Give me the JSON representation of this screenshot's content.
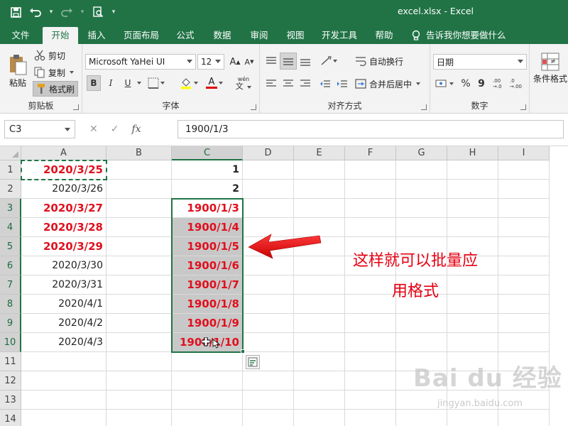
{
  "window": {
    "title": "excel.xlsx  -  Excel"
  },
  "tabs": [
    "文件",
    "开始",
    "插入",
    "页面布局",
    "公式",
    "数据",
    "审阅",
    "视图",
    "开发工具",
    "帮助"
  ],
  "active_tab": "开始",
  "tell_me": "告诉我你想要做什么",
  "ribbon": {
    "clipboard": {
      "paste": "粘贴",
      "cut": "剪切",
      "copy": "复制",
      "format_painter": "格式刷",
      "label": "剪贴板"
    },
    "font": {
      "name": "Microsoft YaHei UI",
      "size": "12",
      "bold": "B",
      "italic": "I",
      "underline": "U",
      "label": "字体",
      "phonetic": "wén",
      "font_color_glyph": "A"
    },
    "alignment": {
      "wrap": "自动换行",
      "merge": "合并后居中",
      "label": "对齐方式"
    },
    "number": {
      "format": "日期",
      "percent": "%",
      "comma": "9",
      "inc": ".00 →.0",
      "dec": ".0 →.00",
      "label": "数字"
    },
    "styles": {
      "conditional": "条件格式"
    }
  },
  "formula_bar": {
    "name_box": "C3",
    "fx": "fx",
    "value": "1900/1/3"
  },
  "columns": [
    "A",
    "B",
    "C",
    "D",
    "E",
    "F",
    "G",
    "H",
    "I"
  ],
  "rows": [
    "1",
    "2",
    "3",
    "4",
    "5",
    "6",
    "7",
    "8",
    "9",
    "10",
    "11",
    "12",
    "13",
    "14"
  ],
  "cells": {
    "A": [
      "2020/3/25",
      "2020/3/26",
      "2020/3/27",
      "2020/3/28",
      "2020/3/29",
      "2020/3/30",
      "2020/3/31",
      "2020/4/1",
      "2020/4/2",
      "2020/4/3"
    ],
    "A_red_rows": [
      0,
      2,
      3,
      4
    ],
    "C": [
      "1",
      "2",
      "1900/1/3",
      "1900/1/4",
      "1900/1/5",
      "1900/1/6",
      "1900/1/7",
      "1900/1/8",
      "1900/1/9",
      "1900/1/10"
    ]
  },
  "annotation": {
    "line1": "这样就可以批量应",
    "line2": "用格式"
  },
  "colors": {
    "excel_green": "#217346",
    "annotation_red": "#e60012",
    "cell_red": "#e0101e"
  },
  "watermark": {
    "brand": "Bai du 经验",
    "url": "jingyan.baidu.com"
  }
}
